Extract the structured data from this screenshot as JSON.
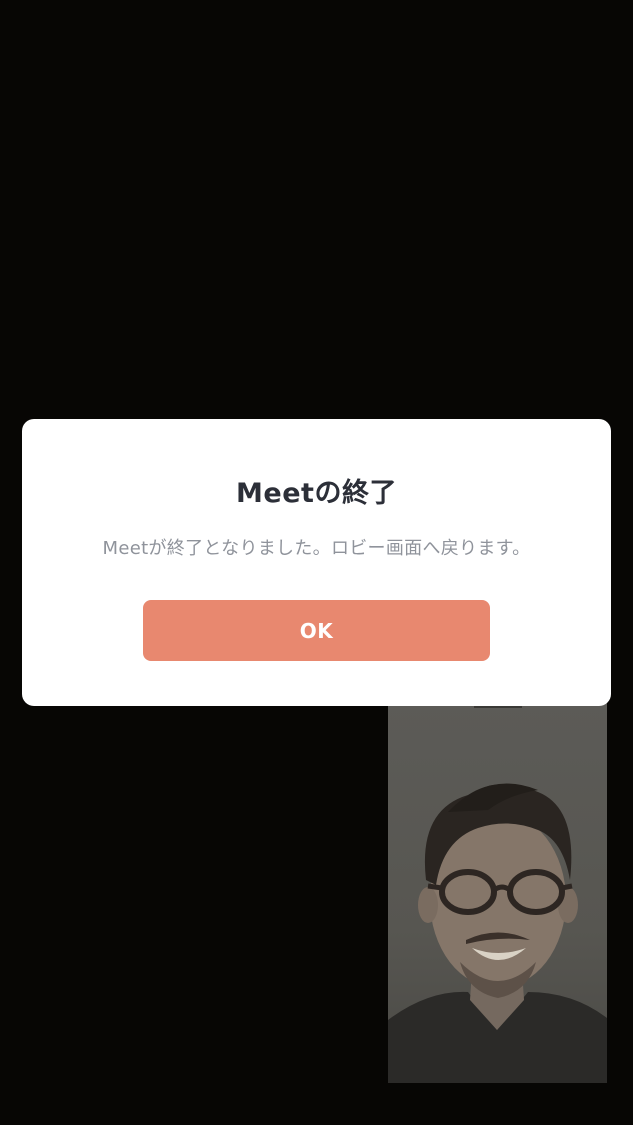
{
  "dialog": {
    "title": "Meetの終了",
    "message": "Meetが終了となりました。ロビー画面へ戻ります。",
    "ok_label": "OK"
  },
  "colors": {
    "background": "#070604",
    "dialog_background": "#ffffff",
    "title_text": "#2c2f38",
    "message_text": "#8f939b",
    "ok_button": "#e8886f",
    "ok_button_text": "#ffffff"
  }
}
